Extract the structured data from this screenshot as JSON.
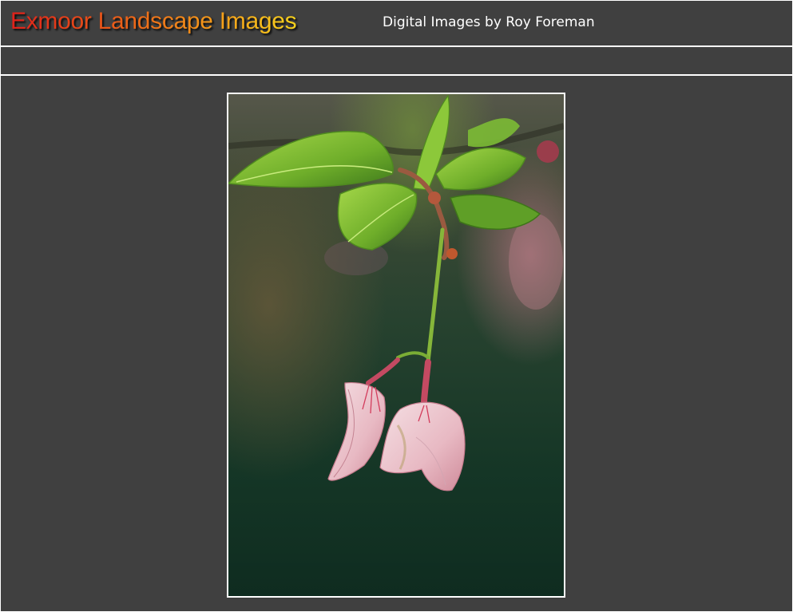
{
  "header": {
    "title": "Exmoor Landscape Images",
    "subtitle": "Digital Images by Roy Foreman"
  },
  "nav": {
    "items": []
  },
  "main": {
    "photo": {
      "subject": "blossom-photo"
    }
  },
  "colors": {
    "background": "#404040",
    "rule": "#ffffff",
    "title_gradient_start": "#e0201a",
    "title_gradient_end": "#f7d21c",
    "subtitle_text": "#ffffff"
  }
}
